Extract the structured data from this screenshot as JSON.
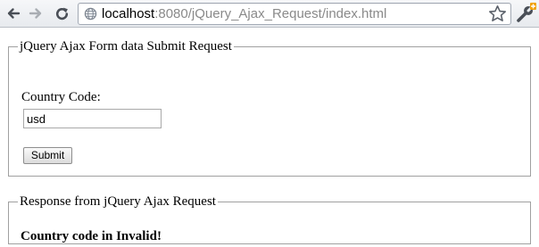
{
  "browser": {
    "url_host": "localhost",
    "url_rest": ":8080/jQuery_Ajax_Request/index.html",
    "icons": {
      "back": "back-arrow-icon",
      "forward": "forward-arrow-icon",
      "reload": "reload-icon",
      "site": "globe-icon",
      "bookmark": "star-icon",
      "menu": "wrench-icon"
    }
  },
  "form": {
    "legend": "jQuery Ajax Form data Submit Request",
    "country_label": "Country Code:",
    "country_value": "usd",
    "submit_label": "Submit"
  },
  "response": {
    "legend": "Response from jQuery Ajax Request",
    "message": "Country code in Invalid!"
  }
}
